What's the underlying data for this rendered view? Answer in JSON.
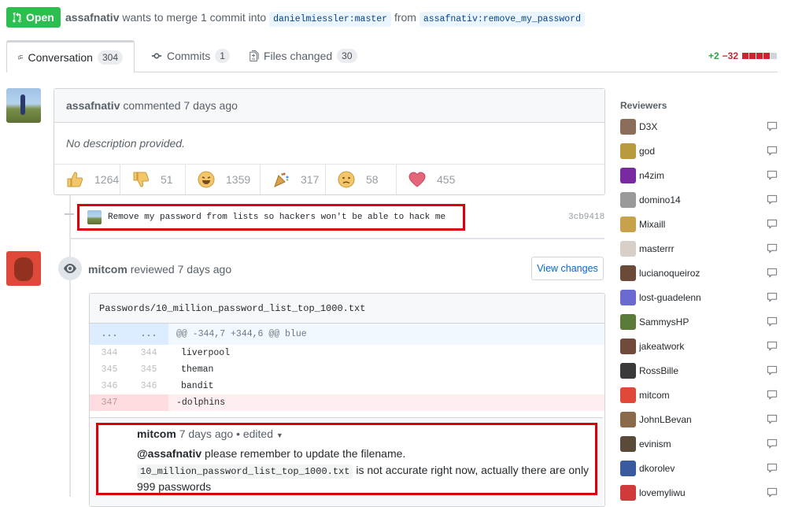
{
  "pr": {
    "state": "Open",
    "author": "assafnativ",
    "merge_text": "wants to merge 1 commit into",
    "base_branch": "danielmiessler:master",
    "from_text": "from",
    "head_branch": "assafnativ:remove_my_password"
  },
  "tabs": [
    {
      "label": "Conversation",
      "count": "304"
    },
    {
      "label": "Commits",
      "count": "1"
    },
    {
      "label": "Files changed",
      "count": "30"
    }
  ],
  "diffstat": {
    "additions": "+2",
    "deletions": "−32"
  },
  "first_comment": {
    "author": "assafnativ",
    "action": "commented 7 days ago",
    "body": "No description provided.",
    "reactions": [
      {
        "icon": "thumbs-up-icon",
        "count": "1264"
      },
      {
        "icon": "thumbs-down-icon",
        "count": "51"
      },
      {
        "icon": "laugh-icon",
        "count": "1359"
      },
      {
        "icon": "hooray-icon",
        "count": "317"
      },
      {
        "icon": "confused-icon",
        "count": "58"
      },
      {
        "icon": "heart-icon",
        "count": "455"
      }
    ]
  },
  "commit": {
    "message": "Remove my password from lists so hackers won't be able to hack me",
    "sha": "3cb9418"
  },
  "review": {
    "author": "mitcom",
    "action": "reviewed 7 days ago",
    "view_changes": "View changes"
  },
  "file": {
    "path": "Passwords/10_million_password_list_top_1000.txt",
    "hunk_left": "...",
    "hunk_right": "...",
    "hunk_header": "@@ -344,7 +344,6 @@ blue",
    "lines": [
      {
        "old": "344",
        "new": "344",
        "code": "liverpool"
      },
      {
        "old": "345",
        "new": "345",
        "code": "theman"
      },
      {
        "old": "346",
        "new": "346",
        "code": "bandit"
      }
    ],
    "deleted": {
      "old": "347",
      "code": "-dolphins"
    }
  },
  "inline_comment": {
    "author": "mitcom",
    "meta": "7 days ago • edited",
    "mention": "@assafnativ",
    "text1": "please remember to update the filename.",
    "code": "10_million_password_list_top_1000.txt",
    "text2": "is not accurate right now, actually there are only",
    "text3": "999 passwords"
  },
  "sidebar": {
    "title": "Reviewers",
    "reviewers": [
      {
        "name": "D3X",
        "color": "#8a6d5a"
      },
      {
        "name": "god",
        "color": "#b89b3c"
      },
      {
        "name": "n4zim",
        "color": "#7a2aa0"
      },
      {
        "name": "domino14",
        "color": "#9a9a9a"
      },
      {
        "name": "Mixaill",
        "color": "#c8a24a"
      },
      {
        "name": "masterrr",
        "color": "#d8d0c8"
      },
      {
        "name": "lucianoqueiroz",
        "color": "#6b4a3a"
      },
      {
        "name": "lost-guadelenn",
        "color": "#6a6ad0"
      },
      {
        "name": "SammysHP",
        "color": "#5a7a3a"
      },
      {
        "name": "jakeatwork",
        "color": "#704a3a"
      },
      {
        "name": "RossBille",
        "color": "#3a3a3a"
      },
      {
        "name": "mitcom",
        "color": "#e0493a"
      },
      {
        "name": "JohnLBevan",
        "color": "#8a6a4a"
      },
      {
        "name": "evinism",
        "color": "#5a4a3a"
      },
      {
        "name": "dkorolev",
        "color": "#3a5aa0"
      },
      {
        "name": "lovemyliwu",
        "color": "#d03a3a"
      }
    ]
  }
}
